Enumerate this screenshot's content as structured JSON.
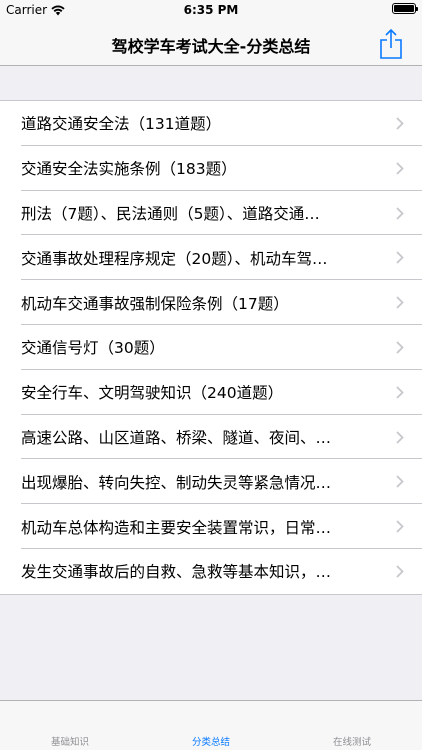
{
  "status_bar": {
    "carrier": "Carrier",
    "time": "6:35 PM",
    "battery_level": 1.0
  },
  "nav": {
    "title": "驾校学车考试大全-分类总结",
    "share_icon": "share-icon"
  },
  "list": {
    "items": [
      {
        "label": "道路交通安全法（131道题）"
      },
      {
        "label": "交通安全法实施条例（183题）"
      },
      {
        "label": "刑法（7题）、民法通则（5题）、道路交通…"
      },
      {
        "label": "交通事故处理程序规定（20题）、机动车驾…"
      },
      {
        "label": "机动车交通事故强制保险条例（17题）"
      },
      {
        "label": "交通信号灯（30题）"
      },
      {
        "label": "安全行车、文明驾驶知识（240道题）"
      },
      {
        "label": "高速公路、山区道路、桥梁、隧道、夜间、…"
      },
      {
        "label": "出现爆胎、转向失控、制动失灵等紧急情况…"
      },
      {
        "label": "机动车总体构造和主要安全装置常识，日常…"
      },
      {
        "label": "发生交通事故后的自救、急救等基本知识，…"
      }
    ]
  },
  "tab_bar": {
    "tabs": [
      {
        "label": "基础知识"
      },
      {
        "label": "分类总结"
      },
      {
        "label": "在线测试"
      }
    ],
    "active_color": "#0a7aff",
    "inactive_color": "#8e8e93"
  }
}
